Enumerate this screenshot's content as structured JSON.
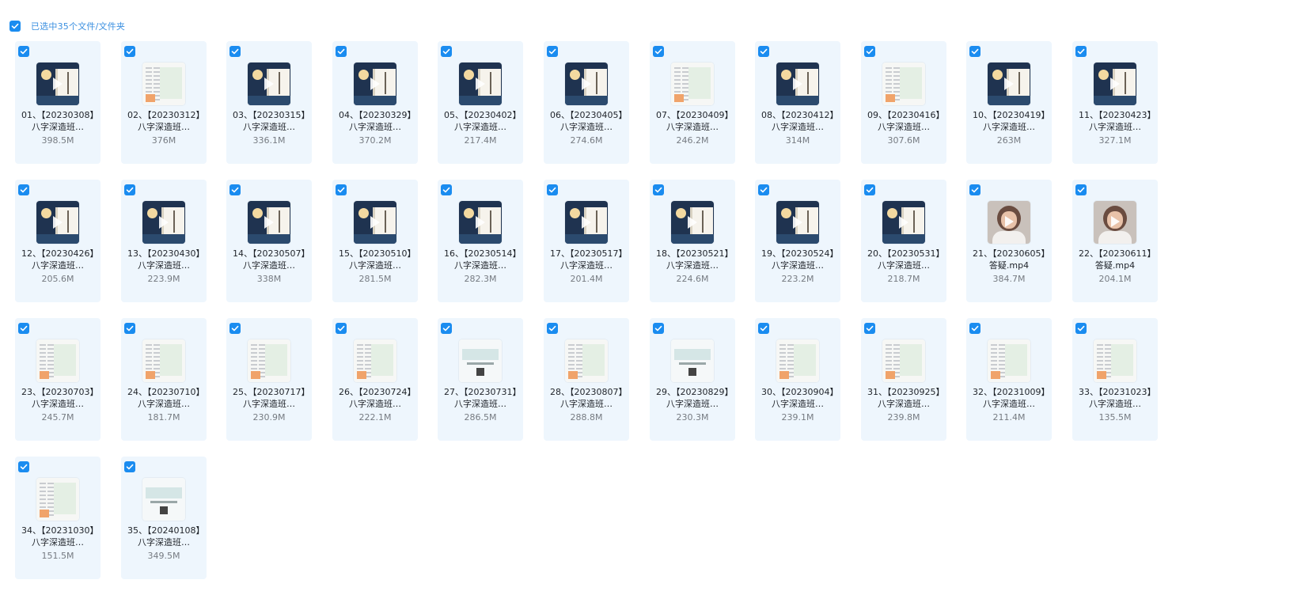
{
  "header": {
    "select_label": "已选中35个文件/文件夹",
    "checked": true
  },
  "colors": {
    "accent": "#1a8cf0",
    "card_bg": "#eef6fd"
  },
  "files": [
    {
      "name": "01、【20230308】八字深造班…",
      "size": "398.5M",
      "thumb": "video"
    },
    {
      "name": "02、【20230312】八字深造班…",
      "size": "376M",
      "thumb": "doc"
    },
    {
      "name": "03、【20230315】八字深造班…",
      "size": "336.1M",
      "thumb": "video"
    },
    {
      "name": "04、【20230329】八字深造班…",
      "size": "370.2M",
      "thumb": "video"
    },
    {
      "name": "05、【20230402】八字深造班…",
      "size": "217.4M",
      "thumb": "video"
    },
    {
      "name": "06、【20230405】八字深造班…",
      "size": "274.6M",
      "thumb": "video"
    },
    {
      "name": "07、【20230409】八字深造班…",
      "size": "246.2M",
      "thumb": "doc"
    },
    {
      "name": "08、【20230412】八字深造班…",
      "size": "314M",
      "thumb": "video"
    },
    {
      "name": "09、【20230416】八字深造班…",
      "size": "307.6M",
      "thumb": "doc"
    },
    {
      "name": "10、【20230419】八字深造班…",
      "size": "263M",
      "thumb": "video"
    },
    {
      "name": "11、【20230423】八字深造班…",
      "size": "327.1M",
      "thumb": "video"
    },
    {
      "name": "12、【20230426】八字深造班…",
      "size": "205.6M",
      "thumb": "video"
    },
    {
      "name": "13、【20230430】八字深造班…",
      "size": "223.9M",
      "thumb": "video"
    },
    {
      "name": "14、【20230507】八字深造班…",
      "size": "338M",
      "thumb": "video"
    },
    {
      "name": "15、【20230510】八字深造班…",
      "size": "281.5M",
      "thumb": "video"
    },
    {
      "name": "16、【20230514】八字深造班…",
      "size": "282.3M",
      "thumb": "video"
    },
    {
      "name": "17、【20230517】八字深造班…",
      "size": "201.4M",
      "thumb": "video"
    },
    {
      "name": "18、【20230521】八字深造班…",
      "size": "224.6M",
      "thumb": "video"
    },
    {
      "name": "19、【20230524】八字深造班…",
      "size": "223.2M",
      "thumb": "video"
    },
    {
      "name": "20、【20230531】八字深造班…",
      "size": "218.7M",
      "thumb": "video"
    },
    {
      "name": "21、【20230605】答疑.mp4",
      "size": "384.7M",
      "thumb": "face"
    },
    {
      "name": "22、【20230611】答疑.mp4",
      "size": "204.1M",
      "thumb": "face"
    },
    {
      "name": "23、【20230703】八字深造班…",
      "size": "245.7M",
      "thumb": "doc"
    },
    {
      "name": "24、【20230710】八字深造班…",
      "size": "181.7M",
      "thumb": "doc"
    },
    {
      "name": "25、【20230717】八字深造班…",
      "size": "230.9M",
      "thumb": "doc"
    },
    {
      "name": "26、【20230724】八字深造班…",
      "size": "222.1M",
      "thumb": "doc"
    },
    {
      "name": "27、【20230731】八字深造班…",
      "size": "286.5M",
      "thumb": "doc2"
    },
    {
      "name": "28、【20230807】八字深造班…",
      "size": "288.8M",
      "thumb": "doc"
    },
    {
      "name": "29、【20230829】八字深造班…",
      "size": "230.3M",
      "thumb": "doc2"
    },
    {
      "name": "30、【20230904】八字深造班…",
      "size": "239.1M",
      "thumb": "doc"
    },
    {
      "name": "31、【20230925】八字深造班…",
      "size": "239.8M",
      "thumb": "doc"
    },
    {
      "name": "32、【20231009】八字深造班…",
      "size": "211.4M",
      "thumb": "doc"
    },
    {
      "name": "33、【20231023】八字深造班…",
      "size": "135.5M",
      "thumb": "doc"
    },
    {
      "name": "34、【20231030】八字深造班…",
      "size": "151.5M",
      "thumb": "doc"
    },
    {
      "name": "35、【20240108】八字深造班…",
      "size": "349.5M",
      "thumb": "doc2"
    }
  ]
}
